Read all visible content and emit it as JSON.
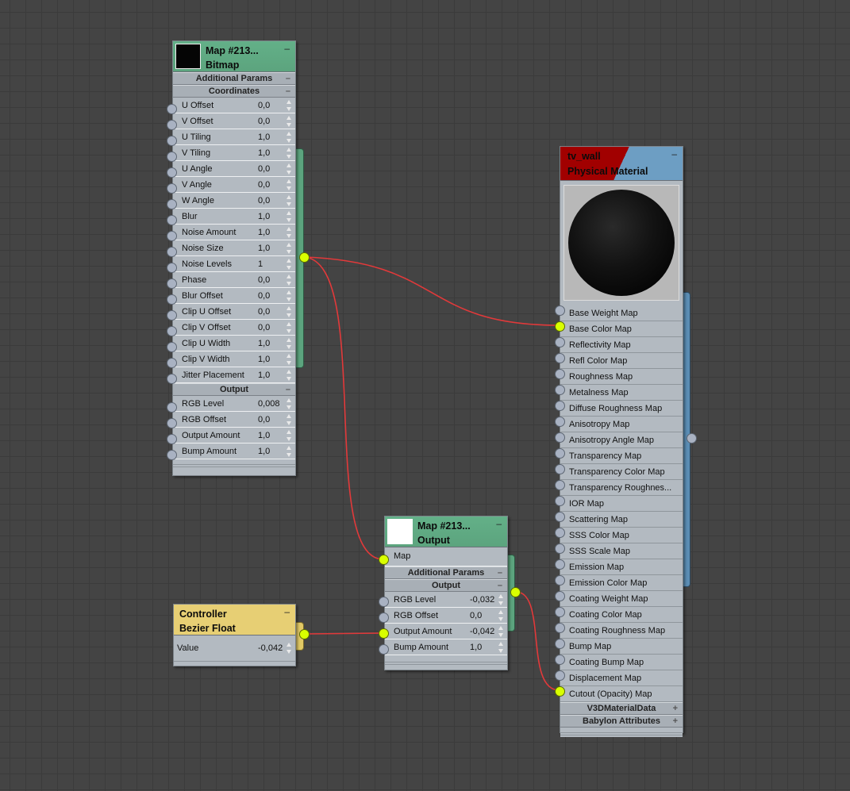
{
  "bitmap_node": {
    "title": "Map  #213...",
    "subtitle": "Bitmap",
    "collapse": "–",
    "sections": {
      "additional_params": "Additional Params",
      "coordinates": "Coordinates",
      "output": "Output"
    },
    "coord_rows": [
      {
        "label": "U Offset",
        "value": "0,0"
      },
      {
        "label": "V Offset",
        "value": "0,0"
      },
      {
        "label": "U Tiling",
        "value": "1,0"
      },
      {
        "label": "V Tiling",
        "value": "1,0"
      },
      {
        "label": "U Angle",
        "value": "0,0"
      },
      {
        "label": "V Angle",
        "value": "0,0"
      },
      {
        "label": "W Angle",
        "value": "0,0"
      },
      {
        "label": "Blur",
        "value": "1,0"
      },
      {
        "label": "Noise Amount",
        "value": "1,0"
      },
      {
        "label": "Noise Size",
        "value": "1,0"
      },
      {
        "label": "Noise Levels",
        "value": "1"
      },
      {
        "label": "Phase",
        "value": "0,0"
      },
      {
        "label": "Blur Offset",
        "value": "0,0"
      },
      {
        "label": "Clip U Offset",
        "value": "0,0"
      },
      {
        "label": "Clip V Offset",
        "value": "0,0"
      },
      {
        "label": "Clip U Width",
        "value": "1,0"
      },
      {
        "label": "Clip V Width",
        "value": "1,0"
      },
      {
        "label": "Jitter Placement",
        "value": "1,0"
      }
    ],
    "output_rows": [
      {
        "label": "RGB Level",
        "value": "0,008"
      },
      {
        "label": "RGB Offset",
        "value": "0,0"
      },
      {
        "label": "Output Amount",
        "value": "1,0"
      },
      {
        "label": "Bump Amount",
        "value": "1,0"
      }
    ]
  },
  "output_node": {
    "title": "Map  #213...",
    "subtitle": "Output",
    "collapse": "–",
    "map_label": "Map",
    "sections": {
      "additional_params": "Additional Params",
      "output": "Output"
    },
    "rows": [
      {
        "label": "RGB Level",
        "value": "-0,032"
      },
      {
        "label": "RGB Offset",
        "value": "0,0"
      },
      {
        "label": "Output Amount",
        "value": "-0,042"
      },
      {
        "label": "Bump Amount",
        "value": "1,0"
      }
    ]
  },
  "controller_node": {
    "title": "Controller",
    "subtitle": "Bezier Float",
    "collapse": "–",
    "row": {
      "label": "Value",
      "value": "-0,042"
    }
  },
  "material_node": {
    "title": "tv_wall",
    "subtitle": "Physical Material",
    "collapse": "–",
    "maps": [
      "Base Weight Map",
      "Base Color Map",
      "Reflectivity Map",
      "Refl Color Map",
      "Roughness Map",
      "Metalness Map",
      "Diffuse Roughness Map",
      "Anisotropy Map",
      "Anisotropy Angle Map",
      "Transparency Map",
      "Transparency Color Map",
      "Transparency Roughnes...",
      "IOR Map",
      "Scattering Map",
      "SSS Color Map",
      "SSS Scale Map",
      "Emission Map",
      "Emission Color Map",
      "Coating Weight Map",
      "Coating Color Map",
      "Coating Roughness Map",
      "Bump Map",
      "Coating Bump Map",
      "Displacement Map",
      "Cutout (Opacity) Map"
    ],
    "rollouts": [
      {
        "label": "V3DMaterialData",
        "icon": "+"
      },
      {
        "label": "Babylon Attributes",
        "icon": "+"
      }
    ]
  },
  "colors": {
    "canvas": "#444444",
    "node_body": "#b3bac1",
    "map_header": "#5fa983",
    "material_header_red": "#9e0000",
    "material_header_blue": "#6e9fc4",
    "controller_header": "#e7cf74",
    "wire": "#e2393a",
    "socket_connected": "#d9ff00",
    "socket_idle": "#a9b2c2"
  }
}
